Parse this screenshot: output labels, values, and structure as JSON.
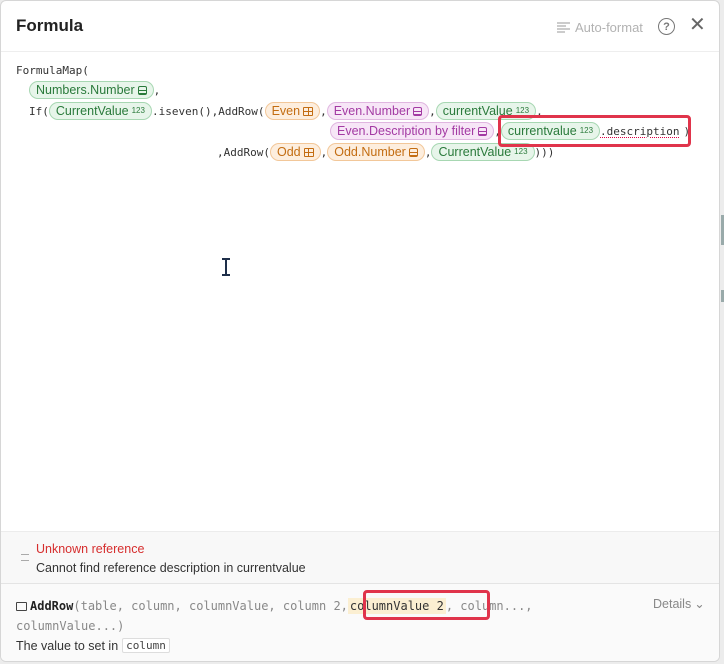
{
  "dialog": {
    "title": "Formula",
    "autoformat_label": "Auto-format",
    "help_glyph": "?",
    "close_glyph": "✕"
  },
  "formula": {
    "l1": "FormulaMap(",
    "l2_chip": "Numbers.Number",
    "l2_tail": ",",
    "l3_if": "If(",
    "l3_chip1": "CurrentValue",
    "l3_mid": ".iseven(),AddRow(",
    "l3_chip2": "Even",
    "l3_chip3": "Even.Number",
    "l3_chip4": "currentValue",
    "l4_chip1": "Even.Description by filter",
    "l4_chip2": "currentvalue",
    "l4_text": ".description",
    "l4_close": ")",
    "l5_text": ",AddRow(",
    "l5_chip1": "Odd",
    "l5_chip2": "Odd.Number",
    "l5_chip3": "CurrentValue",
    "l5_close": ")))",
    "comma": ",",
    "num_badge": "123"
  },
  "error": {
    "title": "Unknown reference",
    "message": "Cannot find reference description in currentvalue"
  },
  "signature": {
    "fn": "AddRow",
    "open": "(",
    "args_before": "table, column, columnValue, column 2,",
    "current_arg": "columnValue 2",
    "args_after": ", column...,",
    "line2": "columnValue...)",
    "desc_prefix": "The value to set in",
    "desc_code": "column",
    "details_label": "Details",
    "details_glyph": "⌄"
  }
}
